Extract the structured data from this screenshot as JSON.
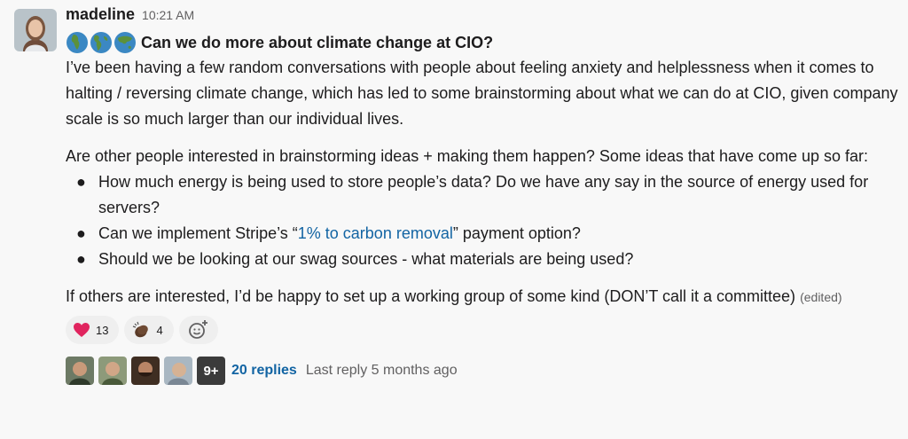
{
  "message": {
    "username": "madeline",
    "timestamp": "10:21 AM",
    "title": "Can we do more about climate change at CIO?",
    "title_emojis": [
      "globe-africa-icon",
      "globe-americas-icon",
      "globe-asia-icon"
    ],
    "paragraph1": "I’ve been having a few random conversations with people about feeling anxiety and helplessness when it comes to halting / reversing climate change, which has led to some brainstorming about what we can do at CIO, given company scale is so much larger than our individual lives.",
    "paragraph2": "Are other people interested in brainstorming ideas + making them happen? Some ideas that have come up so far:",
    "bullets": {
      "b1": "How much energy is being used to store people’s data? Do we have any say in the source of energy used for servers?",
      "b2_before": "Can we implement Stripe’s “",
      "b2_link": "1% to carbon removal",
      "b2_after": "” payment option?",
      "b3": "Should we be looking at our swag sources - what materials are being used?"
    },
    "paragraph3": "If others are interested, I’d be happy to set up a working group of some kind (DON’T call it a committee)",
    "edited": "(edited)"
  },
  "reactions": [
    {
      "icon": "heart-icon",
      "count": "13"
    },
    {
      "icon": "clapping-hands-icon",
      "count": "4"
    }
  ],
  "thread": {
    "more_badge": "9+",
    "reply_count": "20 replies",
    "last_reply": "Last reply 5 months ago"
  },
  "colors": {
    "link": "#1264a3",
    "background": "#f8f8f8",
    "heart": "#e0245e"
  }
}
